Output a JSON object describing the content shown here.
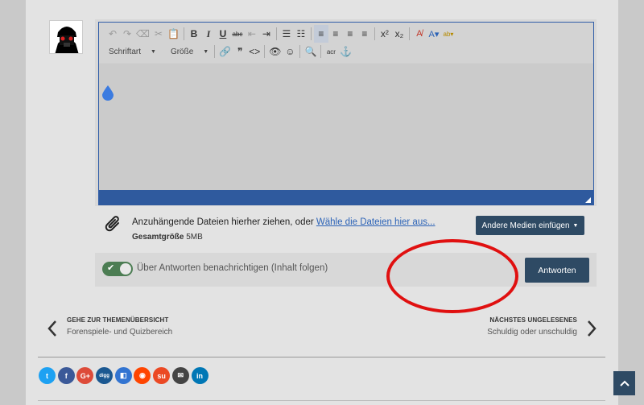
{
  "editor": {
    "toolbar_row1": [
      {
        "name": "undo-icon",
        "glyph": "↶",
        "dim": true
      },
      {
        "name": "redo-icon",
        "glyph": "↷",
        "dim": true
      },
      {
        "name": "remove-format-icon",
        "glyph": "⌫",
        "dim": true
      },
      {
        "name": "cut-icon",
        "glyph": "✂",
        "dim": true
      },
      {
        "name": "paste-icon",
        "glyph": "📋",
        "dim": false
      },
      {
        "sep": true
      },
      {
        "name": "bold-icon",
        "glyph": "B",
        "style": "bold"
      },
      {
        "name": "italic-icon",
        "glyph": "I",
        "style": "italic"
      },
      {
        "name": "underline-icon",
        "glyph": "U",
        "style": "underline"
      },
      {
        "name": "strikethrough-icon",
        "glyph": "abc",
        "style": "strike"
      },
      {
        "name": "outdent-icon",
        "glyph": "⇤",
        "dim": true
      },
      {
        "name": "indent-icon",
        "glyph": "⇥"
      },
      {
        "sep": true
      },
      {
        "name": "bullet-list-icon",
        "glyph": "☰"
      },
      {
        "name": "numbered-list-icon",
        "glyph": "☷"
      },
      {
        "sep": true
      },
      {
        "name": "align-left-icon",
        "glyph": "≡",
        "active": true
      },
      {
        "name": "align-center-icon",
        "glyph": "≡"
      },
      {
        "name": "align-right-icon",
        "glyph": "≡"
      },
      {
        "name": "align-justify-icon",
        "glyph": "≡"
      },
      {
        "sep": true
      },
      {
        "name": "superscript-icon",
        "glyph": "x²"
      },
      {
        "name": "subscript-icon",
        "glyph": "x₂"
      },
      {
        "sep": true
      },
      {
        "name": "clear-format-icon",
        "glyph": "A̸",
        "color": "#c0392b"
      },
      {
        "name": "text-color-icon",
        "glyph": "A▾",
        "color": "#2c63b7"
      },
      {
        "name": "highlight-icon",
        "glyph": "ab▾",
        "color": "#b58a00"
      }
    ],
    "font_label": "Schriftart",
    "size_label": "Größe",
    "toolbar_row2": [
      {
        "name": "link-icon",
        "glyph": "🔗"
      },
      {
        "name": "quote-icon",
        "glyph": "❞"
      },
      {
        "name": "code-icon",
        "glyph": "<>"
      },
      {
        "sep": true
      },
      {
        "name": "preview-eye-icon",
        "glyph": "👁"
      },
      {
        "name": "smiley-icon",
        "glyph": "☺"
      },
      {
        "sep": true
      },
      {
        "name": "find-replace-icon",
        "glyph": "🔍"
      },
      {
        "sep": true
      },
      {
        "name": "acronym-icon",
        "glyph": "acr"
      },
      {
        "name": "anchor-icon",
        "glyph": "⚓"
      }
    ]
  },
  "attachments": {
    "drop_text": "Anzuhängende Dateien hierher ziehen, oder ",
    "choose_link": "Wähle die Dateien hier aus...",
    "total_size_label": "Gesamtgröße",
    "total_size_value": "5MB",
    "media_button": "Andere Medien einfügen"
  },
  "reply": {
    "follow_label": "Über Antworten benachrichtigen (Inhalt folgen)",
    "follow_on": true,
    "submit_label": "Antworten"
  },
  "thread_nav": {
    "prev_title": "GEHE ZUR THEMENÜBERSICHT",
    "prev_sub": "Forenspiele- und Quizbereich",
    "next_title": "NÄCHSTES UNGELESENES",
    "next_sub": "Schuldig oder unschuldig"
  },
  "share_buttons": [
    {
      "name": "twitter-icon",
      "glyph": "t",
      "color": "#1da1f2"
    },
    {
      "name": "facebook-icon",
      "glyph": "f",
      "color": "#3b5998"
    },
    {
      "name": "google-plus-icon",
      "glyph": "G+",
      "color": "#dd4b39"
    },
    {
      "name": "digg-icon",
      "glyph": "digg",
      "color": "#1b5891"
    },
    {
      "name": "delicious-icon",
      "glyph": "◧",
      "color": "#3274d1"
    },
    {
      "name": "reddit-icon",
      "glyph": "◉",
      "color": "#ff4500"
    },
    {
      "name": "stumbleupon-icon",
      "glyph": "su",
      "color": "#eb4924"
    },
    {
      "name": "email-icon",
      "glyph": "✉",
      "color": "#444444"
    },
    {
      "name": "linkedin-icon",
      "glyph": "in",
      "color": "#0077b5"
    }
  ],
  "colors": {
    "accent_dark": "#2e4a64",
    "editor_status": "#2f5a9e",
    "toggle_on": "#4c7d53",
    "annotation_red": "#e01010"
  }
}
